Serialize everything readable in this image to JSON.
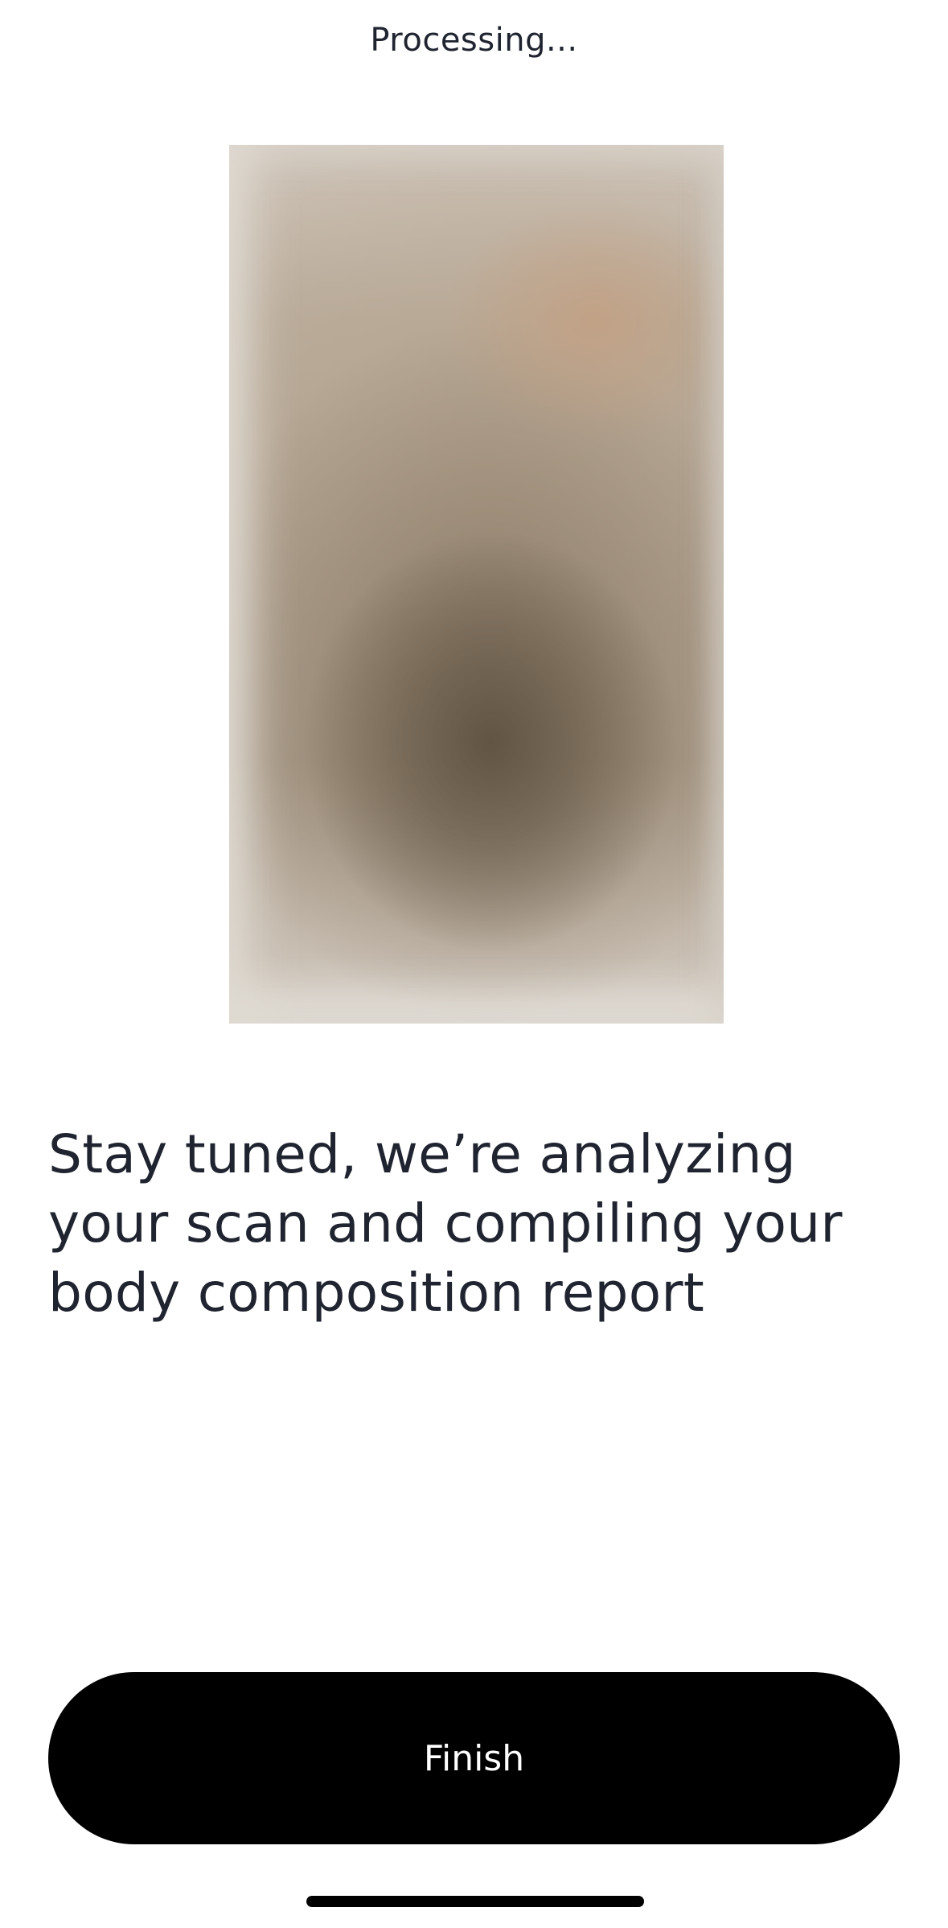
{
  "header": {
    "title": "Processing..."
  },
  "scan_preview": {
    "description_icon": "blurred-body-scan-image"
  },
  "main": {
    "message": "Stay tuned, we’re analyzing your scan and compiling your body composition report"
  },
  "actions": {
    "finish_label": "Finish"
  },
  "colors": {
    "button_background": "#000000",
    "button_text": "#ffffff",
    "text": "#1f2430",
    "background": "#ffffff"
  }
}
